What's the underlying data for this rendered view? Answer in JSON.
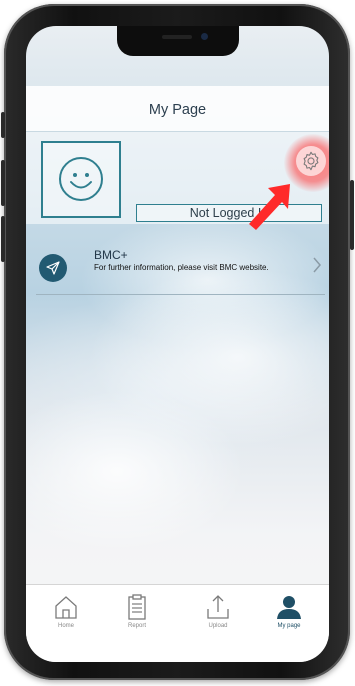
{
  "header": {
    "title": "My Page"
  },
  "profile": {
    "login_status": "Not Logged In"
  },
  "bmc": {
    "title": "BMC+",
    "description": "For further information, please visit BMC website."
  },
  "tabs": [
    {
      "label": "Home",
      "icon": "home-icon",
      "active": false
    },
    {
      "label": "Report",
      "icon": "clipboard-icon",
      "active": false
    },
    {
      "label": "Upload",
      "icon": "upload-icon",
      "active": false
    },
    {
      "label": "My page",
      "icon": "person-icon",
      "active": true
    }
  ],
  "colors": {
    "accent": "#2f7f8f",
    "tab_active": "#1f4f66",
    "highlight": "#ff3b3b"
  }
}
